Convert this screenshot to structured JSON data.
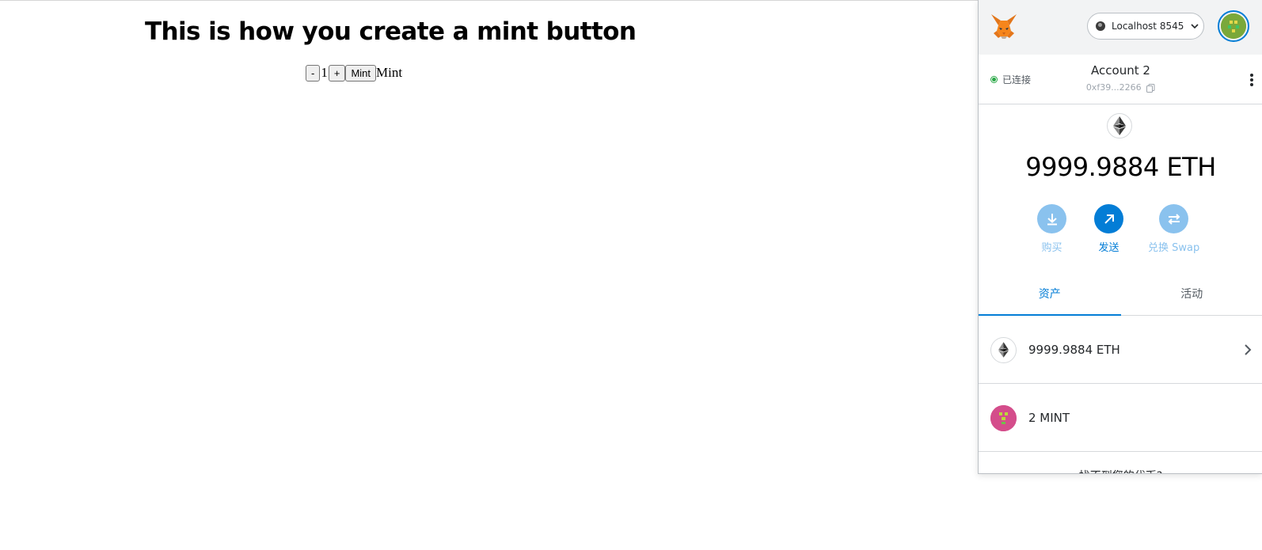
{
  "dapp": {
    "title": "This is how you create a mint button",
    "minus_label": "-",
    "quantity": "1",
    "plus_label": "+",
    "mint_button_label": "Mint",
    "mint_text": "Mint"
  },
  "metamask": {
    "network": "Localhost 8545",
    "connection_status": "已连接",
    "account_name": "Account 2",
    "account_address": "0xf39...2266",
    "balance": "9999.9884 ETH",
    "actions": [
      {
        "label": "购买",
        "icon": "download-icon"
      },
      {
        "label": "发送",
        "icon": "send-arrow-icon"
      },
      {
        "label": "兑换 Swap",
        "icon": "swap-icon"
      }
    ],
    "tabs": [
      "资产",
      "活动"
    ],
    "assets": [
      {
        "label": "9999.9884 ETH",
        "icon": "eth-icon"
      },
      {
        "label": "2 MINT",
        "icon": "mint-token-icon"
      }
    ],
    "find_token_text": "找不到您的代币?"
  },
  "colors": {
    "accent": "#037dd6",
    "accent_faded": "#8ac2ee",
    "connected": "#28a745",
    "header_bg": "#f2f3f4",
    "mint_token": "#d44d8b"
  }
}
